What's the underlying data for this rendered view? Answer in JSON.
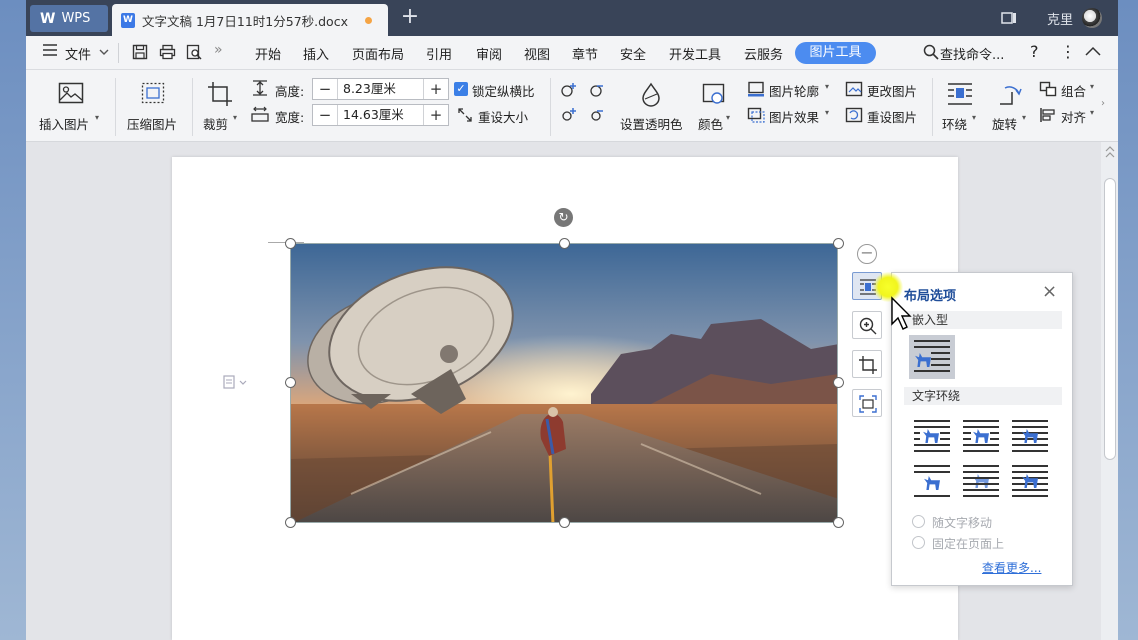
{
  "titlebar": {
    "app_tab": "WPS",
    "doc_tab": "文字文稿 1月7日11时1分57秒.docx",
    "new_tab": "+",
    "user": "克里"
  },
  "menubar": {
    "file": "文件",
    "tabs": [
      "开始",
      "插入",
      "页面布局",
      "引用",
      "审阅",
      "视图",
      "章节",
      "安全",
      "开发工具",
      "云服务",
      "图片工具"
    ],
    "search": "查找命令...",
    "help": "?",
    "more": "⋮",
    "collapse": "︿",
    "active_tab": "图片工具"
  },
  "ribbon": {
    "insert_pic": "插入图片",
    "compress_pic": "压缩图片",
    "crop": "裁剪",
    "height_label": "高度:",
    "height_value": "8.23厘米",
    "width_label": "宽度:",
    "width_value": "14.63厘米",
    "lock_ratio": "锁定纵横比",
    "reset_size": "重设大小",
    "set_transparent": "设置透明色",
    "color": "颜色",
    "outline": "图片轮廓",
    "effect": "图片效果",
    "change_pic": "更改图片",
    "reset_pic": "重设图片",
    "wrap": "环绕",
    "rotate": "旋转",
    "group": "组合",
    "align": "对齐"
  },
  "layout_panel": {
    "title": "布局选项",
    "close": "×",
    "inline_section": "嵌入型",
    "wrap_section": "文字环绕",
    "radio_move": "随文字移动",
    "radio_fixed": "固定在页面上",
    "more_link": "查看更多..."
  },
  "colors": {
    "titlebar": "#394458",
    "accent": "#4c8cf0",
    "panel_title": "#1f4d99",
    "link": "#2f6fd8"
  }
}
